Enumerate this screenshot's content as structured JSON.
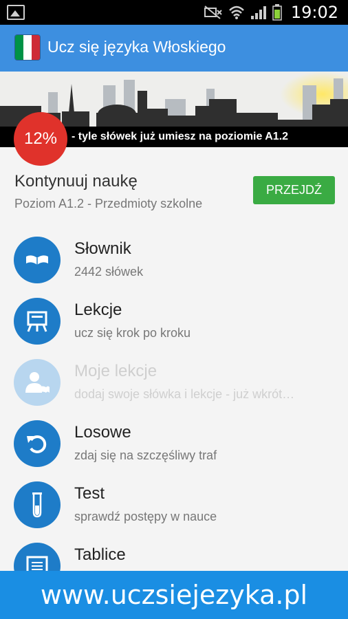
{
  "status_bar": {
    "time": "19:02",
    "icons": [
      "image-icon",
      "mute-icon",
      "wifi-icon",
      "signal-icon",
      "battery-icon"
    ]
  },
  "app_bar": {
    "title": "Ucz się języka Włoskiego",
    "flag_colors": [
      "#009246",
      "#ffffff",
      "#ce2b37"
    ]
  },
  "banner": {
    "progress_percent": "12%",
    "progress_text": "- tyle słówek już umiesz na poziomie A1.2"
  },
  "continue": {
    "title": "Kontynuuj naukę",
    "subtitle": "Poziom A1.2 - Przedmioty szkolne",
    "button_label": "PRZEJDŹ"
  },
  "menu": {
    "items": [
      {
        "label": "Słownik",
        "sub": "2442 słówek",
        "icon": "book-icon",
        "enabled": true
      },
      {
        "label": "Lekcje",
        "sub": "ucz się krok po kroku",
        "icon": "easel-icon",
        "enabled": true
      },
      {
        "label": "Moje lekcje",
        "sub": "dodaj swoje słówka i lekcje - już wkrót…",
        "icon": "user-book-icon",
        "enabled": false
      },
      {
        "label": "Losowe",
        "sub": "zdaj się na szczęśliwy traf",
        "icon": "undo-icon",
        "enabled": true
      },
      {
        "label": "Test",
        "sub": "sprawdź postępy w nauce",
        "icon": "test-tube-icon",
        "enabled": true
      },
      {
        "label": "Tablice",
        "sub": "",
        "icon": "board-icon",
        "enabled": true
      }
    ]
  },
  "footer": {
    "url": "www.uczsiejezyka.pl"
  },
  "colors": {
    "accent": "#3d8fe0",
    "icon_blue": "#1e7cc8",
    "go_green": "#3aab43",
    "progress_red": "#e0322b",
    "footer_blue": "#1a8ee3"
  }
}
